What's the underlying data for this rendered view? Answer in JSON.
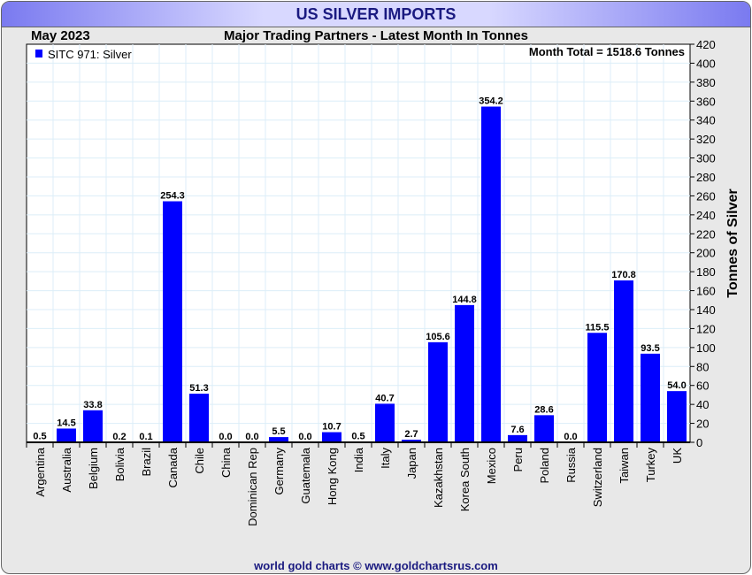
{
  "header": {
    "title": "US SILVER IMPORTS",
    "date": "May 2023",
    "subtitle": "Major Trading Partners - Latest Month In Tonnes",
    "footer": "world gold charts © www.goldchartsrus.com"
  },
  "chart_data": {
    "type": "bar",
    "title": "Major Trading Partners - Latest Month In Tonnes",
    "ylabel": "Tonnes of Silver",
    "xlabel": "",
    "ylim": [
      0,
      420
    ],
    "ytick_step": 20,
    "legend": {
      "label": "SITC 971: Silver",
      "placement": "top-left"
    },
    "annotation": "Month Total = 1518.6 Tonnes",
    "bar_color": "#0000ff",
    "categories": [
      "Argentina",
      "Australia",
      "Belgium",
      "Bolivia",
      "Brazil",
      "Canada",
      "Chile",
      "China",
      "Dominican Rep",
      "Germany",
      "Guatemala",
      "Hong Kong",
      "India",
      "Italy",
      "Japan",
      "Kazakhstan",
      "Korea South",
      "Mexico",
      "Peru",
      "Poland",
      "Russia",
      "Switzerland",
      "Taiwan",
      "Turkey",
      "UK"
    ],
    "values": [
      0.5,
      14.5,
      33.8,
      0.2,
      0.1,
      254.3,
      51.3,
      0.0,
      0.0,
      5.5,
      0.0,
      10.7,
      0.5,
      40.7,
      2.7,
      105.6,
      144.8,
      354.2,
      7.6,
      28.6,
      0.0,
      115.5,
      170.8,
      93.5,
      54.0
    ]
  }
}
